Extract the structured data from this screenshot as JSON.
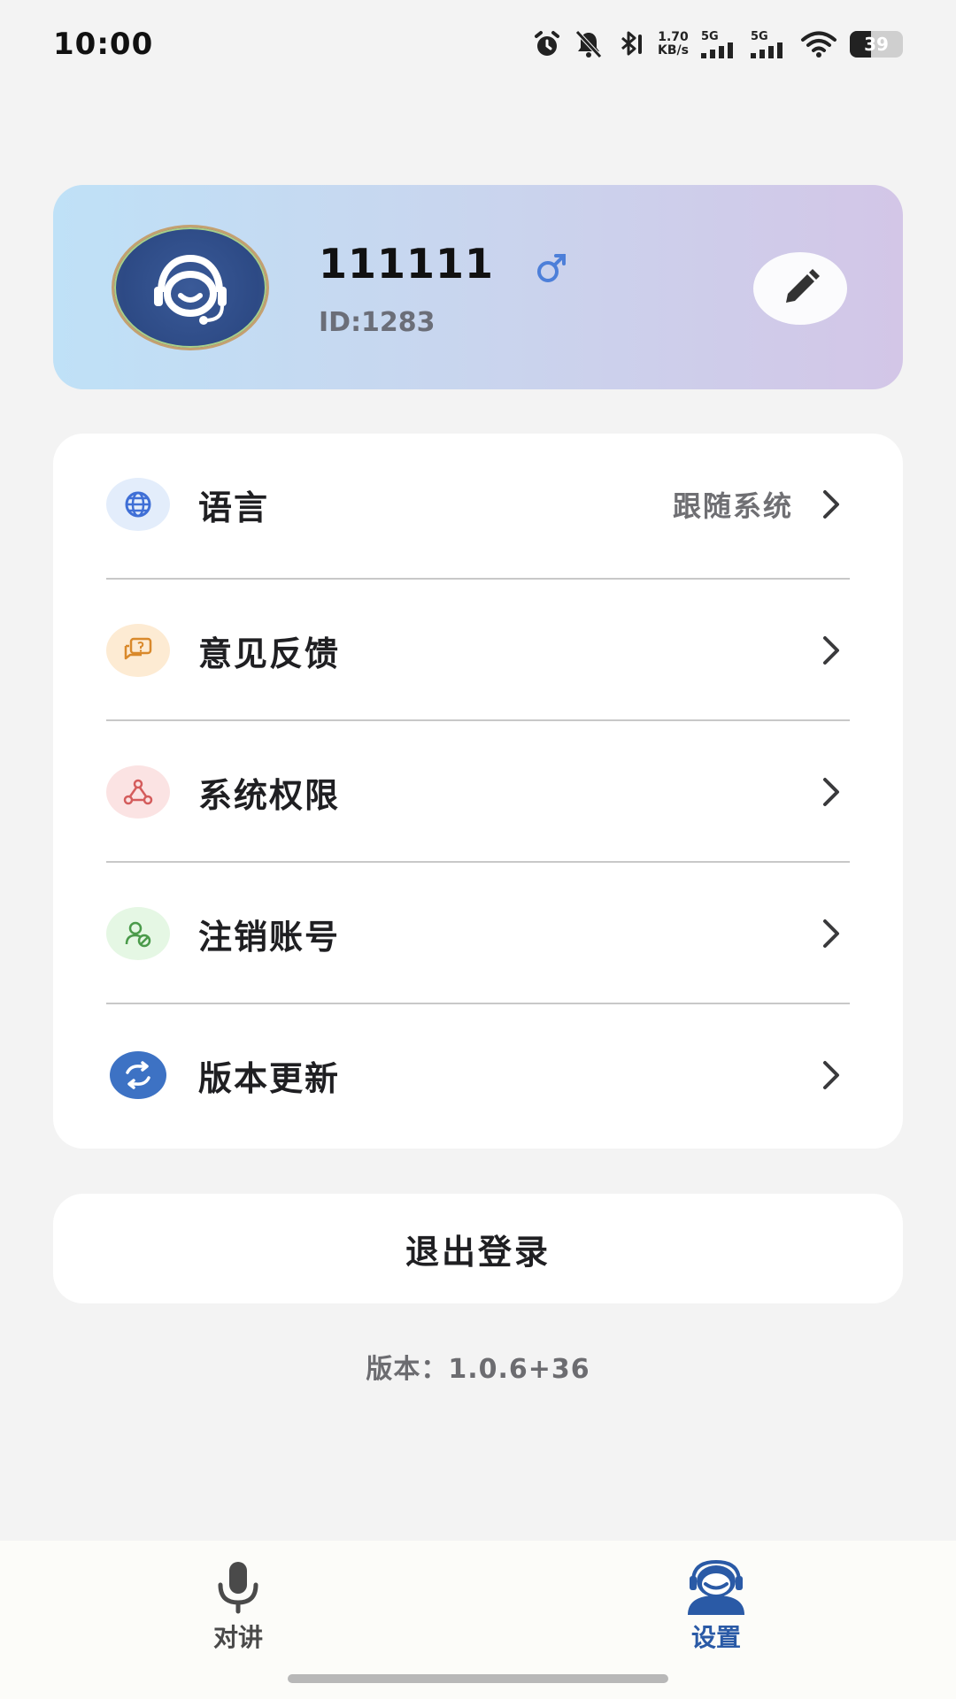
{
  "status_bar": {
    "time": "10:00",
    "net_speed_value": "1.70",
    "net_speed_unit": "KB/s",
    "signal_1_label": "5G",
    "signal_2_label": "5G",
    "battery_level": "39",
    "icons": [
      "alarm-icon",
      "mute-icon",
      "bluetooth-icon",
      "signal-icon",
      "signal-icon",
      "wifi-icon",
      "battery-icon"
    ]
  },
  "profile": {
    "name": "111111",
    "gender_icon": "male-icon",
    "id_text": "ID:1283",
    "avatar_icon": "customer-service-icon",
    "edit_icon": "pencil-icon"
  },
  "settings": {
    "items": [
      {
        "label": "语言",
        "value": "跟随系统",
        "icon": "globe-icon",
        "icon_bg": "#e3edfb",
        "icon_color": "#3f6fd6"
      },
      {
        "label": "意见反馈",
        "value": "",
        "icon": "feedback-icon",
        "icon_bg": "#fdebd3",
        "icon_color": "#d9892b"
      },
      {
        "label": "系统权限",
        "value": "",
        "icon": "permission-icon",
        "icon_bg": "#fbe3e3",
        "icon_color": "#d45c5c"
      },
      {
        "label": "注销账号",
        "value": "",
        "icon": "account-cancel-icon",
        "icon_bg": "#e5f7e4",
        "icon_color": "#4a9a4a"
      },
      {
        "label": "版本更新",
        "value": "",
        "icon": "update-icon",
        "icon_bg": "#3d72c4",
        "icon_color": "#ffffff"
      }
    ]
  },
  "logout": {
    "label": "退出登录"
  },
  "version": {
    "text": "版本：1.0.6+36"
  },
  "bottom_nav": {
    "items": [
      {
        "label": "对讲",
        "icon": "microphone-icon",
        "active": false,
        "color": "#4a4a4a"
      },
      {
        "label": "设置",
        "icon": "headset-person-icon",
        "active": true,
        "color": "#2a5aa6"
      }
    ]
  }
}
